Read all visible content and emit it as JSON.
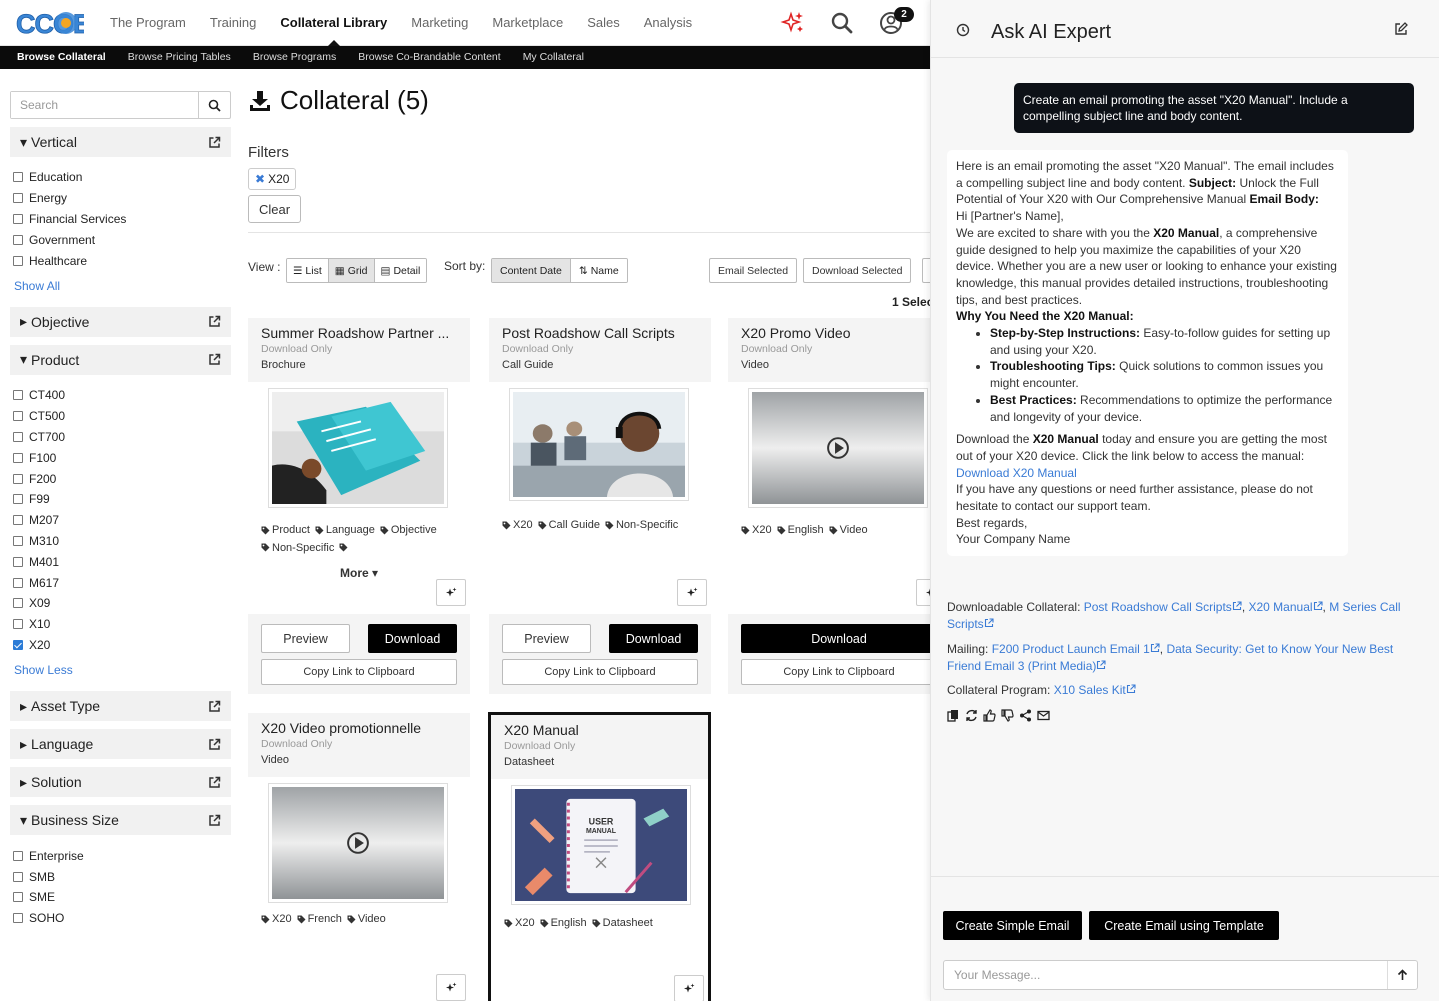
{
  "brand": {
    "logo_text": "CCOE",
    "accent": "#2b7bd6",
    "sparkle_color": "#e02424"
  },
  "topnav": {
    "items": [
      {
        "label": "The Program"
      },
      {
        "label": "Training"
      },
      {
        "label": "Collateral Library",
        "active": true
      },
      {
        "label": "Marketing"
      },
      {
        "label": "Marketplace"
      },
      {
        "label": "Sales"
      },
      {
        "label": "Analysis"
      }
    ],
    "icons": [
      "ai-sparkle-icon",
      "search-icon",
      "user-icon"
    ],
    "notification_count": "2"
  },
  "subnav": {
    "items": [
      {
        "label": "Browse Collateral",
        "active": true
      },
      {
        "label": "Browse Pricing Tables"
      },
      {
        "label": "Browse Programs"
      },
      {
        "label": "Browse Co-Brandable Content"
      },
      {
        "label": "My Collateral"
      }
    ]
  },
  "sidebar": {
    "search_placeholder": "Search",
    "facets": [
      {
        "title": "Vertical",
        "expanded": true,
        "options": [
          {
            "label": "Education",
            "checked": false
          },
          {
            "label": "Energy",
            "checked": false
          },
          {
            "label": "Financial Services",
            "checked": false
          },
          {
            "label": "Government",
            "checked": false
          },
          {
            "label": "Healthcare",
            "checked": false
          }
        ],
        "toggle_label": "Show All"
      },
      {
        "title": "Objective",
        "expanded": false
      },
      {
        "title": "Product",
        "expanded": true,
        "options": [
          {
            "label": "CT400",
            "checked": false
          },
          {
            "label": "CT500",
            "checked": false
          },
          {
            "label": "CT700",
            "checked": false
          },
          {
            "label": "F100",
            "checked": false
          },
          {
            "label": "F200",
            "checked": false
          },
          {
            "label": "F99",
            "checked": false
          },
          {
            "label": "M207",
            "checked": false
          },
          {
            "label": "M310",
            "checked": false
          },
          {
            "label": "M401",
            "checked": false
          },
          {
            "label": "M617",
            "checked": false
          },
          {
            "label": "X09",
            "checked": false
          },
          {
            "label": "X10",
            "checked": false
          },
          {
            "label": "X20",
            "checked": true
          }
        ],
        "toggle_label": "Show Less"
      },
      {
        "title": "Asset Type",
        "expanded": false
      },
      {
        "title": "Language",
        "expanded": false
      },
      {
        "title": "Solution",
        "expanded": false
      },
      {
        "title": "Business Size",
        "expanded": true,
        "options": [
          {
            "label": "Enterprise",
            "checked": false
          },
          {
            "label": "SMB",
            "checked": false
          },
          {
            "label": "SME",
            "checked": false
          },
          {
            "label": "SOHO",
            "checked": false
          }
        ]
      }
    ]
  },
  "main": {
    "title": "Collateral (5)",
    "filters_label": "Filters",
    "active_filter": "X20",
    "clear_label": "Clear",
    "view_label": "View :",
    "views": [
      {
        "label": "List"
      },
      {
        "label": "Grid",
        "active": true
      },
      {
        "label": "Detail"
      }
    ],
    "sort_label": "Sort by:",
    "sorts": [
      {
        "label": "Content Date",
        "active": true
      },
      {
        "label": "Name"
      }
    ],
    "email_selected": "Email Selected",
    "download_selected": "Download Selected",
    "selected_count": "1 Selec",
    "more_label": "More",
    "preview_label": "Preview",
    "download_label": "Download",
    "copy_label": "Copy Link to Clipboard",
    "cards": [
      {
        "title": "Summer Roadshow Partner ...",
        "sub": "Download Only",
        "type": "Brochure",
        "tags": [
          "Product",
          "Language",
          "Objective",
          "Non-Specific",
          ""
        ]
      },
      {
        "title": "Post Roadshow Call Scripts",
        "sub": "Download Only",
        "type": "Call Guide",
        "tags": [
          "X20",
          "Call Guide",
          "Non-Specific"
        ]
      },
      {
        "title": "X20 Promo Video",
        "sub": "Download Only",
        "type": "Video",
        "tags": [
          "X20",
          "English",
          "Video"
        ]
      },
      {
        "title": "X20 Video promotionnelle",
        "sub": "Download Only",
        "type": "Video",
        "tags": [
          "X20",
          "French",
          "Video"
        ]
      },
      {
        "title": "X20 Manual",
        "sub": "Download Only",
        "type": "Datasheet",
        "tags": [
          "X20",
          "English",
          "Datasheet"
        ],
        "selected": true,
        "thumb_text": [
          "USER",
          "MANUAL"
        ]
      }
    ]
  },
  "ai": {
    "title": "Ask AI Expert",
    "user_message": "Create an email promoting the asset \"X20 Manual\". Include a compelling subject line and body content.",
    "response": {
      "intro": "Here is an email promoting the asset \"X20 Manual\". The email includes a compelling subject line and body content. ",
      "subject_label": "Subject:",
      "subject": " Unlock the Full Potential of Your X20 with Our Comprehensive Manual ",
      "body_label": "Email Body:",
      "greeting": "Hi [Partner's Name],",
      "p1_a": "We are excited to share with you the ",
      "p1_bold": "X20 Manual",
      "p1_b": ", a comprehensive guide designed to help you maximize the capabilities of your X20 device. Whether you are a new user or looking to enhance your existing knowledge, this manual provides detailed instructions, troubleshooting tips, and best practices.",
      "why_heading": "Why You Need the X20 Manual:",
      "bullets": [
        {
          "bold": "Step-by-Step Instructions:",
          "text": " Easy-to-follow guides for setting up and using your X20."
        },
        {
          "bold": "Troubleshooting Tips:",
          "text": " Quick solutions to common issues you might encounter."
        },
        {
          "bold": "Best Practices:",
          "text": " Recommendations to optimize the performance and longevity of your device."
        }
      ],
      "p2_a": "Download the ",
      "p2_bold": "X20 Manual",
      "p2_b": " today and ensure you are getting the most out of your X20 device. Click the link below to access the manual:",
      "link": "Download X20 Manual",
      "p3": "If you have any questions or need further assistance, please do not hesitate to contact our support team.",
      "signoff": "Best regards,",
      "signature": "Your Company Name"
    },
    "downloadable_label": "Downloadable Collateral:",
    "downloadable": [
      "Post Roadshow Call Scripts",
      "X20 Manual",
      "M Series Call Scripts"
    ],
    "mailing_label": "Mailing:",
    "mailing": [
      "F200 Product Launch Email 1",
      "Data Security: Get to Know Your New Best Friend Email 3 (Print Media)"
    ],
    "program_label": "Collateral Program:",
    "program": "X10 Sales Kit",
    "tools": [
      "copy-icon",
      "regenerate-icon",
      "thumbs-up-icon",
      "thumbs-down-icon",
      "share-icon",
      "email-icon"
    ],
    "btn_simple": "Create Simple Email",
    "btn_template": "Create Email using Template",
    "input_placeholder": "Your Message..."
  }
}
